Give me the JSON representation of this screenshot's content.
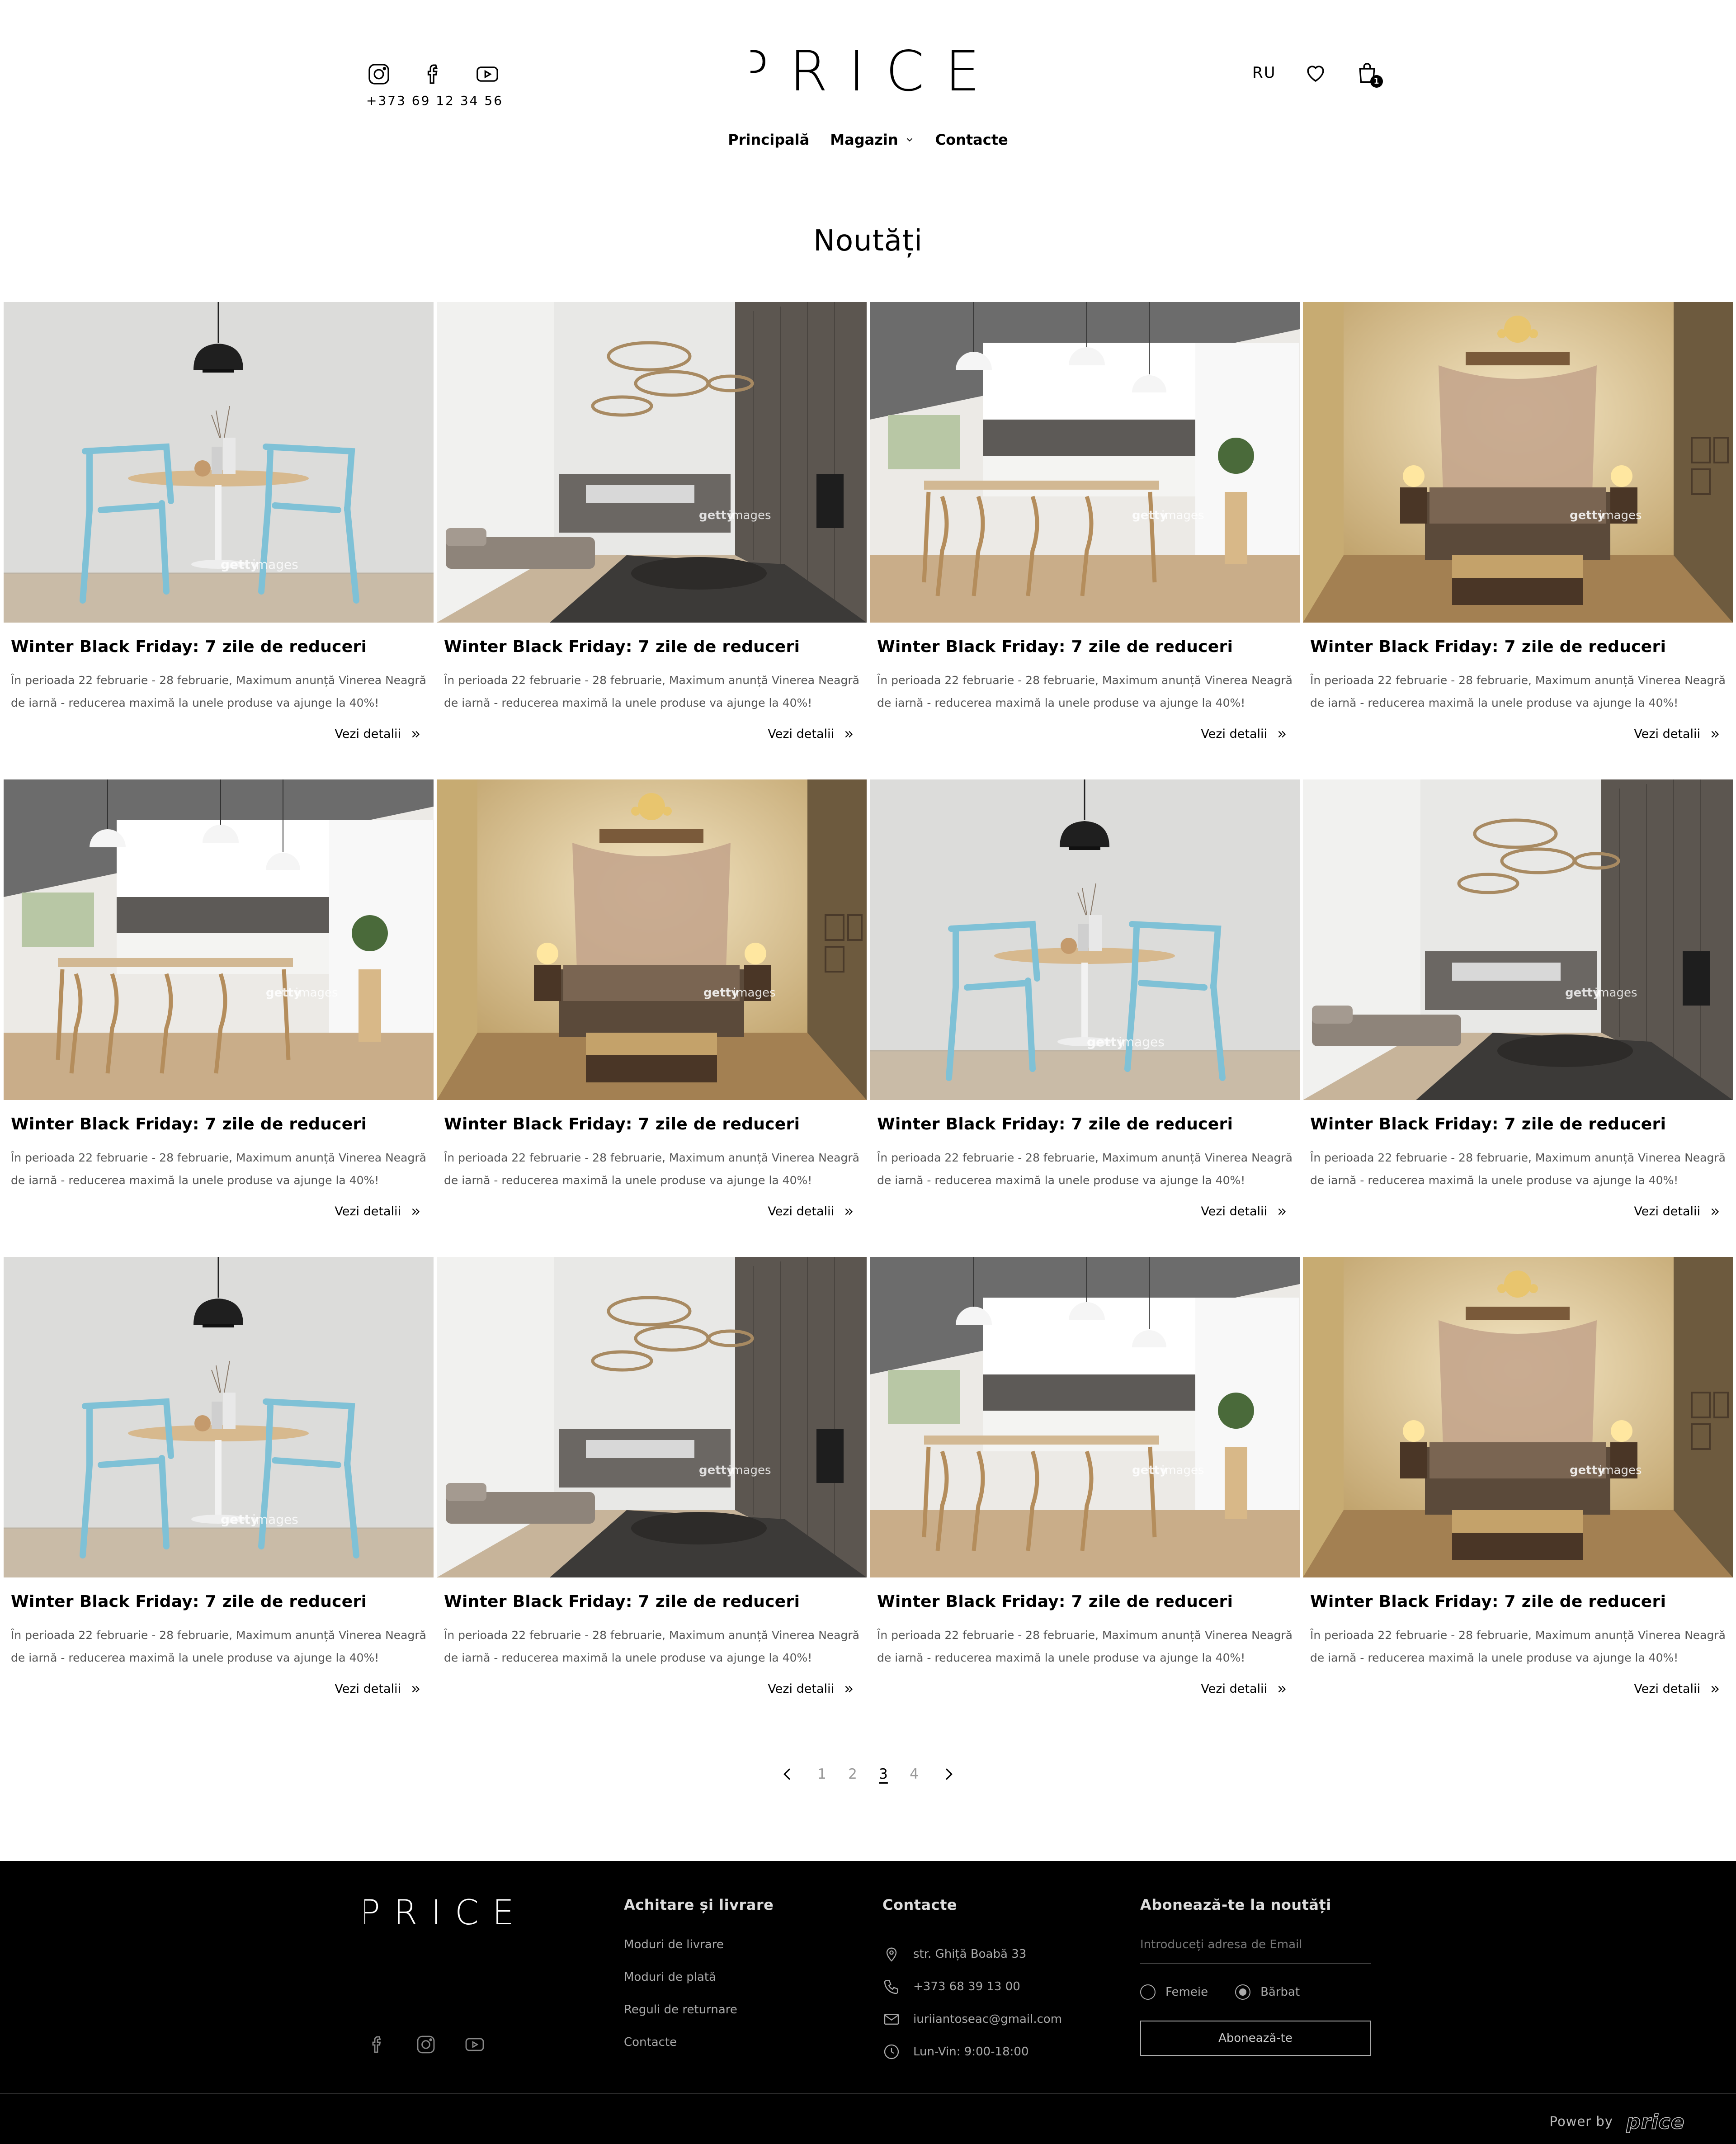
{
  "header": {
    "phone": "+373 69 12 34 56",
    "logo": "PRICE",
    "language": "RU",
    "cart_count": "1",
    "social": [
      "instagram-icon",
      "facebook-icon",
      "youtube-icon"
    ]
  },
  "nav": {
    "home": "Principală",
    "shop": "Magazin",
    "contacts": "Contacte"
  },
  "page": {
    "title": "Noutăți"
  },
  "news": [
    {
      "image": "dining",
      "title": "Winter Black Friday: 7 zile de reduceri",
      "excerpt": "În perioada 22 februarie - 28 februarie, Maximum anunță Vinerea Neagră de iarnă - reducerea maximă la unele produse va ajunge la 40%!",
      "more": "Vezi detalii"
    },
    {
      "image": "living",
      "title": "Winter Black Friday: 7 zile de reduceri",
      "excerpt": "În perioada 22 februarie - 28 februarie, Maximum anunță Vinerea Neagră de iarnă - reducerea maximă la unele produse va ajunge la 40%!",
      "more": "Vezi detalii"
    },
    {
      "image": "kitchen",
      "title": "Winter Black Friday: 7 zile de reduceri",
      "excerpt": "În perioada 22 februarie - 28 februarie, Maximum anunță Vinerea Neagră de iarnă - reducerea maximă la unele produse va ajunge la 40%!",
      "more": "Vezi detalii"
    },
    {
      "image": "bedroom",
      "title": "Winter Black Friday: 7 zile de reduceri",
      "excerpt": "În perioada 22 februarie - 28 februarie, Maximum anunță Vinerea Neagră de iarnă - reducerea maximă la unele produse va ajunge la 40%!",
      "more": "Vezi detalii"
    },
    {
      "image": "kitchen",
      "title": "Winter Black Friday: 7 zile de reduceri",
      "excerpt": "În perioada 22 februarie - 28 februarie, Maximum anunță Vinerea Neagră de iarnă - reducerea maximă la unele produse va ajunge la 40%!",
      "more": "Vezi detalii"
    },
    {
      "image": "bedroom",
      "title": "Winter Black Friday: 7 zile de reduceri",
      "excerpt": "În perioada 22 februarie - 28 februarie, Maximum anunță Vinerea Neagră de iarnă - reducerea maximă la unele produse va ajunge la 40%!",
      "more": "Vezi detalii"
    },
    {
      "image": "dining",
      "title": "Winter Black Friday: 7 zile de reduceri",
      "excerpt": "În perioada 22 februarie - 28 februarie, Maximum anunță Vinerea Neagră de iarnă - reducerea maximă la unele produse va ajunge la 40%!",
      "more": "Vezi detalii"
    },
    {
      "image": "living",
      "title": "Winter Black Friday: 7 zile de reduceri",
      "excerpt": "În perioada 22 februarie - 28 februarie, Maximum anunță Vinerea Neagră de iarnă - reducerea maximă la unele produse va ajunge la 40%!",
      "more": "Vezi detalii"
    },
    {
      "image": "dining",
      "title": "Winter Black Friday: 7 zile de reduceri",
      "excerpt": "În perioada 22 februarie - 28 februarie, Maximum anunță Vinerea Neagră de iarnă - reducerea maximă la unele produse va ajunge la 40%!",
      "more": "Vezi detalii"
    },
    {
      "image": "living",
      "title": "Winter Black Friday: 7 zile de reduceri",
      "excerpt": "În perioada 22 februarie - 28 februarie, Maximum anunță Vinerea Neagră de iarnă - reducerea maximă la unele produse va ajunge la 40%!",
      "more": "Vezi detalii"
    },
    {
      "image": "kitchen",
      "title": "Winter Black Friday: 7 zile de reduceri",
      "excerpt": "În perioada 22 februarie - 28 februarie, Maximum anunță Vinerea Neagră de iarnă - reducerea maximă la unele produse va ajunge la 40%!",
      "more": "Vezi detalii"
    },
    {
      "image": "bedroom",
      "title": "Winter Black Friday: 7 zile de reduceri",
      "excerpt": "În perioada 22 februarie - 28 februarie, Maximum anunță Vinerea Neagră de iarnă - reducerea maximă la unele produse va ajunge la 40%!",
      "more": "Vezi detalii"
    }
  ],
  "pagination": {
    "pages": [
      "1",
      "2",
      "3",
      "4"
    ],
    "current": "3"
  },
  "footer": {
    "logo": "PRICE",
    "col1": {
      "title": "Achitare și livrare",
      "links": [
        "Moduri de livrare",
        "Moduri de plată",
        "Reguli de returnare",
        "Contacte"
      ]
    },
    "col2": {
      "title": "Contacte",
      "address": "str. Ghiță Boabă 33",
      "phone": "+373 68 39 13 00",
      "email": "iuriiantoseac@gmail.com",
      "hours": "Lun-Vin: 9:00-18:00"
    },
    "col3": {
      "title": "Abonează-te la noutăți",
      "email_placeholder": "Introduceți adresa de Email",
      "female": "Femeie",
      "male": "Bărbat",
      "button": "Abonează-te"
    },
    "power_by": "Power by",
    "power_logo": "price"
  },
  "colors": {
    "background": "#ffffff",
    "text": "#000000",
    "footer_bg": "#000000",
    "muted": "#555555"
  }
}
